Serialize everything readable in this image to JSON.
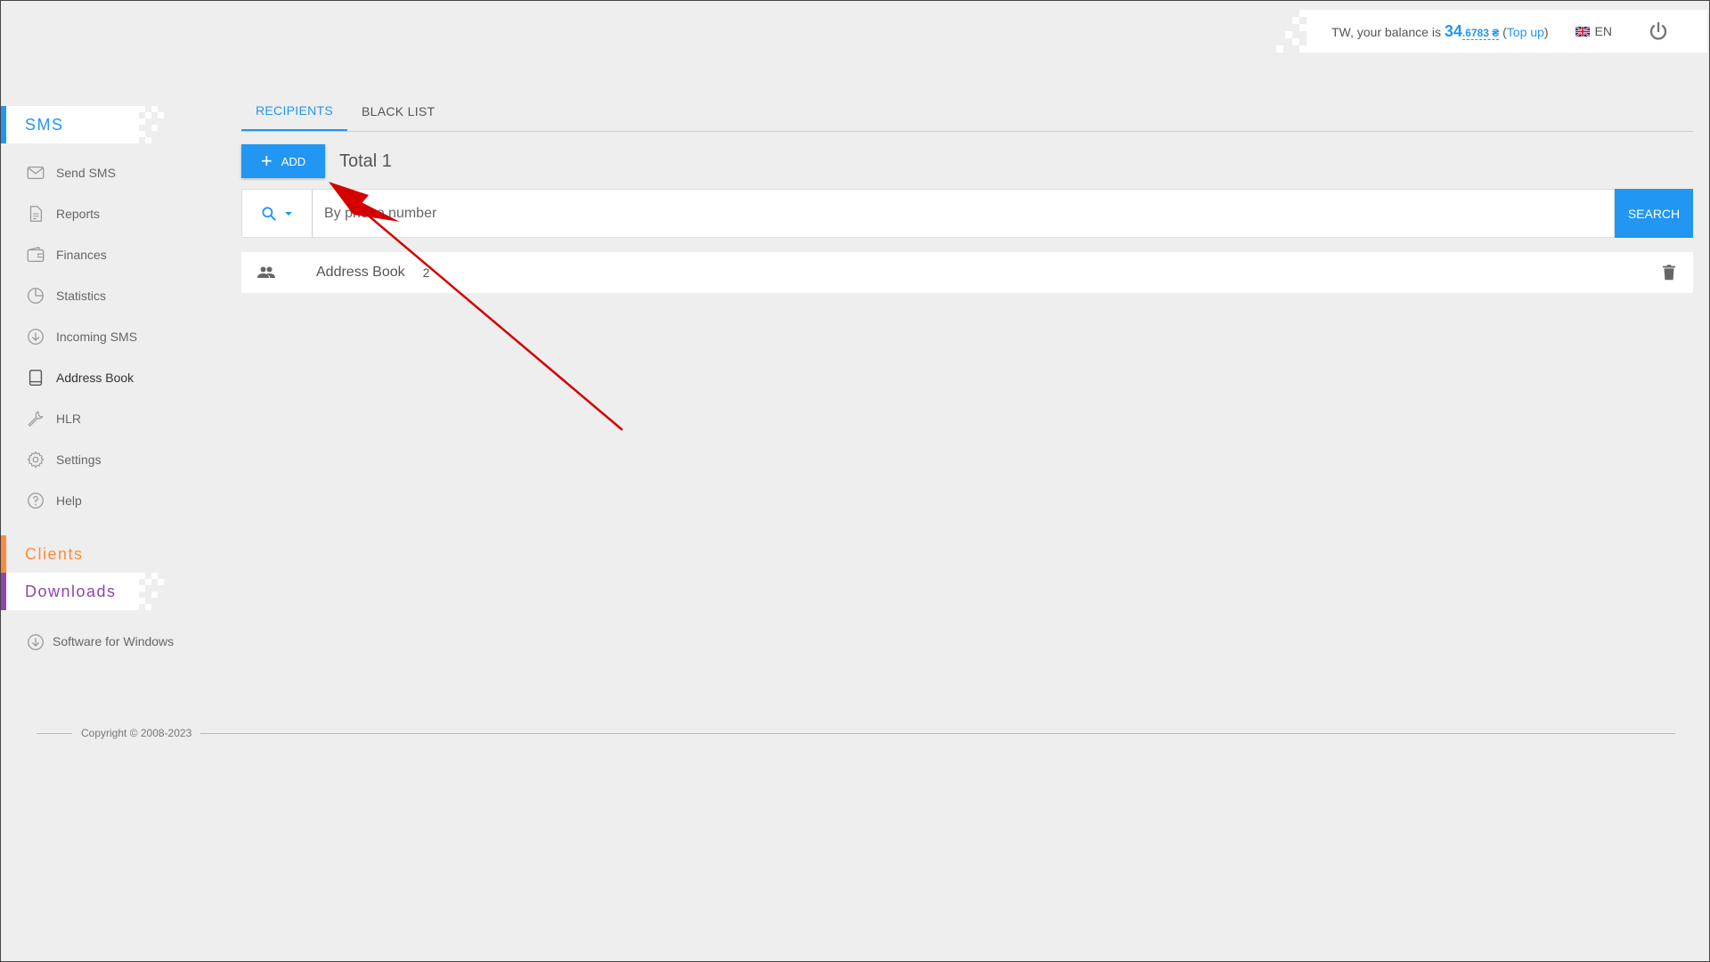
{
  "header": {
    "balance_prefix": "TW, your balance is ",
    "balance_int": "34",
    "balance_frac": ".6783 ₴",
    "topup_open": " (",
    "topup_label": "Top up",
    "topup_close": ")",
    "language": "EN"
  },
  "sidebar": {
    "sms_title": "SMS",
    "items": [
      {
        "label": "Send SMS",
        "icon": "envelope-icon"
      },
      {
        "label": "Reports",
        "icon": "document-icon"
      },
      {
        "label": "Finances",
        "icon": "wallet-icon"
      },
      {
        "label": "Statistics",
        "icon": "pie-chart-icon"
      },
      {
        "label": "Incoming SMS",
        "icon": "download-circle-icon"
      },
      {
        "label": "Address Book",
        "icon": "book-icon"
      },
      {
        "label": "HLR",
        "icon": "wrench-icon"
      },
      {
        "label": "Settings",
        "icon": "gear-icon"
      },
      {
        "label": "Help",
        "icon": "help-circle-icon"
      }
    ],
    "clients_title": "Clients",
    "downloads_title": "Downloads",
    "download_item": "Software for Windows"
  },
  "main": {
    "tabs": [
      {
        "label": "RECIPIENTS",
        "active": true
      },
      {
        "label": "BLACK LIST",
        "active": false
      }
    ],
    "add_label": "ADD",
    "total": "Total 1",
    "search": {
      "placeholder": "By phone number",
      "button": "SEARCH"
    },
    "groups": [
      {
        "name": "Address Book",
        "count": "2"
      }
    ]
  },
  "footer": {
    "copyright": "Copyright © 2008-2023"
  },
  "colors": {
    "accent": "#2196f3",
    "clients": "#ff8a3c",
    "downloads": "#8e44ad",
    "annotation": "#d40000"
  }
}
